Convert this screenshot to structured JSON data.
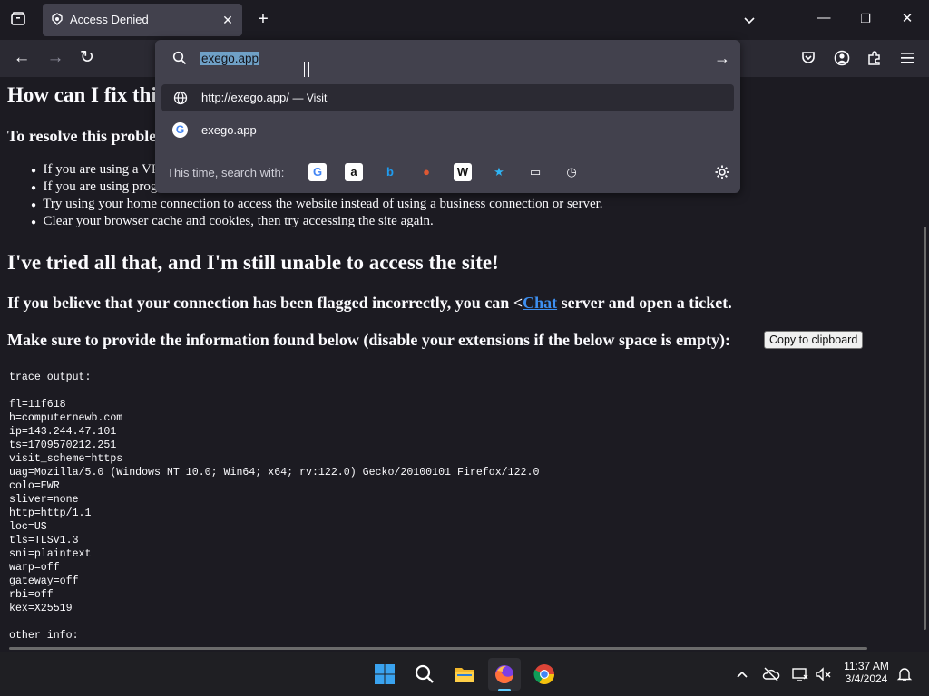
{
  "browser": {
    "tab": {
      "title": "Access Denied"
    },
    "nav": {
      "back": "←",
      "forward": "→",
      "reload": "↻",
      "pocket_icon": "pocket-icon",
      "account_icon": "account-icon",
      "extensions_icon": "extensions-icon",
      "menu_icon": "hamburger-menu-icon"
    },
    "window_controls": {
      "minimize": "—",
      "restore": "❐",
      "close": "✕"
    }
  },
  "urlbar": {
    "value": "exego.app",
    "suggestions": [
      {
        "title": "http://exego.app/",
        "action": "— Visit",
        "icon": "globe-icon"
      },
      {
        "title": "exego.app",
        "icon": "google-icon"
      }
    ],
    "search_with_label": "This time, search with:",
    "engines": [
      {
        "name": "google",
        "glyph": "G",
        "color": "#4285f4",
        "bg": "#ffffff"
      },
      {
        "name": "amazon",
        "glyph": "a",
        "color": "#111111",
        "bg": "#ffffff"
      },
      {
        "name": "bing",
        "glyph": "b",
        "color": "#1f9cf0",
        "bg": "transparent"
      },
      {
        "name": "duckduckgo",
        "glyph": "●",
        "color": "#de5833",
        "bg": "transparent"
      },
      {
        "name": "wikipedia",
        "glyph": "W",
        "color": "#111111",
        "bg": "#ffffff"
      },
      {
        "name": "bookmarks",
        "glyph": "★",
        "color": "#2fb4f4",
        "bg": "transparent"
      },
      {
        "name": "tabs",
        "glyph": "▭",
        "color": "#fbfbfe",
        "bg": "transparent"
      },
      {
        "name": "history",
        "glyph": "◷",
        "color": "#fbfbfe",
        "bg": "transparent"
      }
    ]
  },
  "page": {
    "heading_fix": "How can I fix this problem?",
    "resolve_intro": "To resolve this problem, try the following:",
    "bullets": [
      "If you are using a VPN, try disabling it and accessing the site again.",
      "If you are using programs that may interfere, try disabling them and accessing the site again.",
      "Try using your home connection to access the website instead of using a business connection or server.",
      "Clear your browser cache and cookies, then try accessing the site again."
    ],
    "heading_tried": "I've tried all that, and I'm still unable to access the site!",
    "flagged_before": "If you believe that your connection has been flagged incorrectly, you can <",
    "flagged_link": "Chat",
    "flagged_after": " server and open a ticket.",
    "provide_info": "Make sure to provide the information found below (disable your extensions if the below space is empty):",
    "copy_button": "Copy to clipboard",
    "trace_lines": [
      "trace output:",
      "",
      "fl=11f618",
      "h=computernewb.com",
      "ip=143.244.47.101",
      "ts=1709570212.251",
      "visit_scheme=https",
      "uag=Mozilla/5.0 (Windows NT 10.0; Win64; x64; rv:122.0) Gecko/20100101 Firefox/122.0",
      "colo=EWR",
      "sliver=none",
      "http=http/1.1",
      "loc=US",
      "tls=TLSv1.3",
      "sni=plaintext",
      "warp=off",
      "gateway=off",
      "rbi=off",
      "kex=X25519",
      "",
      "other info:"
    ]
  },
  "taskbar": {
    "apps": [
      "windows-start-icon",
      "search-icon",
      "file-explorer-icon",
      "firefox-icon",
      "chrome-icon"
    ],
    "clock": {
      "time": "11:37 AM",
      "date": "3/4/2024"
    }
  }
}
